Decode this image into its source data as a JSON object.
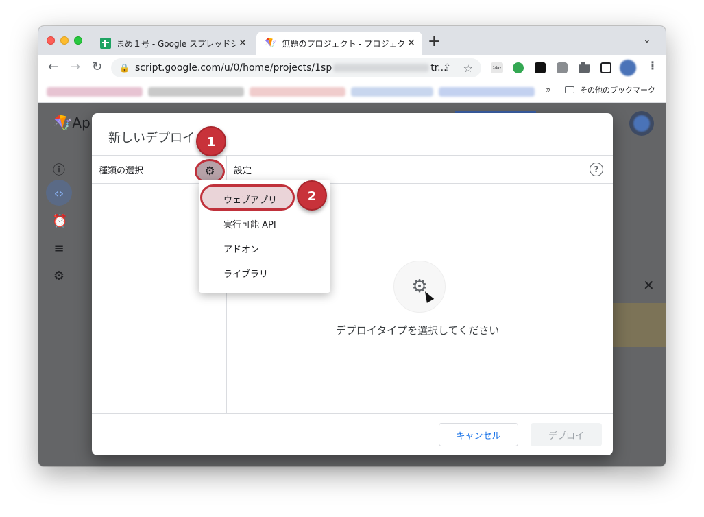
{
  "browser": {
    "tabs": [
      {
        "title": "まめ１号 - Google スプレッドシー",
        "icon": "sheets-icon",
        "active": false
      },
      {
        "title": "無題のプロジェクト - プロジェクト",
        "icon": "apps-script-icon",
        "active": true
      }
    ],
    "new_tab": "+",
    "url": "script.google.com/u/0/home/projects/1sp",
    "url_tail": "tr...",
    "bookmarks_more": "»",
    "bookmarks_folder": "その他のブックマーク",
    "ext_badge": "1day"
  },
  "page_bg": {
    "logo_text": "Ap"
  },
  "dialog": {
    "title": "新しいデプロイ",
    "type_select_label": "種類の選択",
    "settings_label": "設定",
    "help": "?",
    "empty_message": "デプロイタイプを選択してください",
    "cancel_button": "キャンセル",
    "deploy_button": "デプロイ",
    "deploy_types": [
      "ウェブアプリ",
      "実行可能 API",
      "アドオン",
      "ライブラリ"
    ]
  },
  "annotations": {
    "step1": "1",
    "step2": "2",
    "highlight_color": "#c0313b"
  }
}
